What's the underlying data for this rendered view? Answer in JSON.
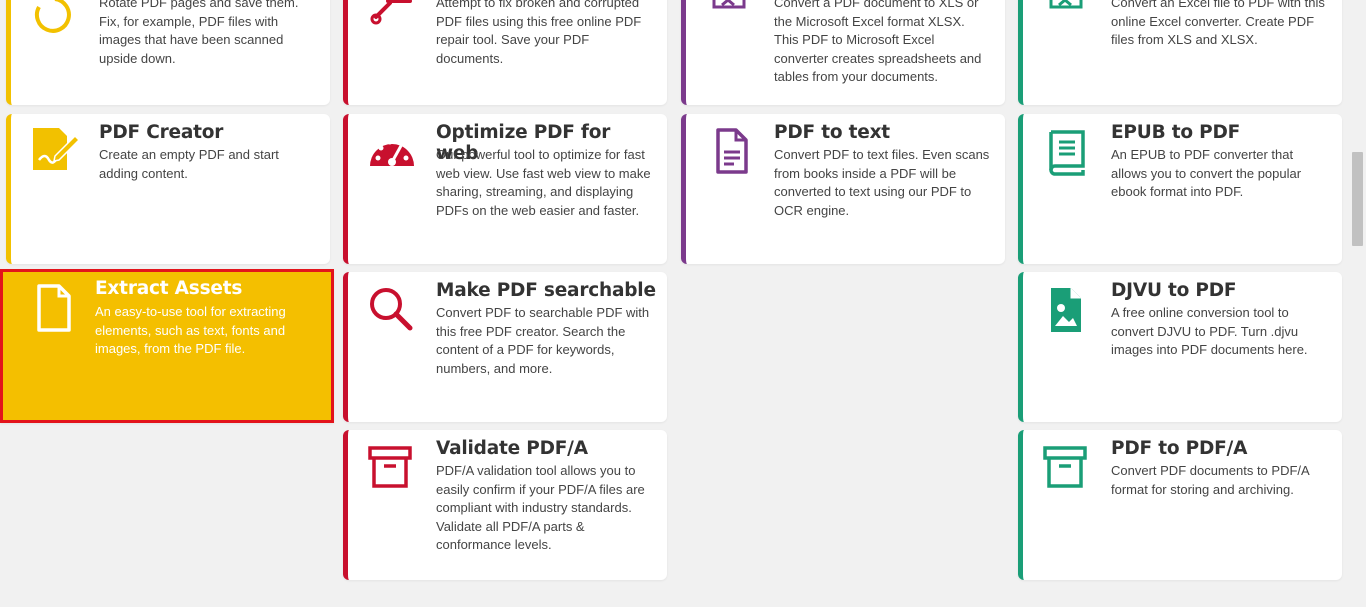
{
  "colors": {
    "yellow": "#f2c100",
    "red": "#c8102e",
    "purple": "#7b3a8c",
    "green": "#1a9e77",
    "highlight": "#f4bf00",
    "selection_border": "#e3141b"
  },
  "cards": {
    "rotate": {
      "desc": "Rotate PDF pages and save them. Fix, for example, PDF files with images that have been scanned upside down.",
      "icon": "rotate-icon"
    },
    "repair": {
      "desc": "Attempt to fix broken and corrupted PDF files using this free online PDF repair tool. Save your PDF documents.",
      "icon": "wrench-icon"
    },
    "pdf_to_excel": {
      "desc": "Convert a PDF document to XLS or the Microsoft Excel format XLSX. This PDF to Microsoft Excel converter creates spreadsheets and tables from your documents.",
      "icon": "excel-file-icon"
    },
    "excel_to_pdf": {
      "desc": "Convert an Excel file to PDF with this online Excel converter. Create PDF files from XLS and XLSX.",
      "icon": "excel-file-icon"
    },
    "pdf_creator": {
      "title": "PDF Creator",
      "desc": "Create an empty PDF and start adding content.",
      "icon": "sign-document-icon"
    },
    "optimize_web": {
      "title": "Optimize PDF for web",
      "desc": "Our powerful tool to optimize for fast web view. Use fast web view to make sharing, streaming, and displaying PDFs on the web easier and faster.",
      "icon": "speedometer-icon"
    },
    "pdf_to_text": {
      "title": "PDF to text",
      "desc": "Convert PDF to text files. Even scans from books inside a PDF will be converted to text using our PDF to OCR engine.",
      "icon": "text-file-icon"
    },
    "epub_to_pdf": {
      "title": "EPUB to PDF",
      "desc": "An EPUB to PDF converter that allows you to convert the popular ebook format into PDF.",
      "icon": "book-icon"
    },
    "extract_assets": {
      "title": "Extract Assets",
      "desc": "An easy-to-use tool for extracting elements, such as text, fonts and images, from the PDF file.",
      "icon": "file-icon"
    },
    "searchable": {
      "title": "Make PDF searchable",
      "desc": "Convert PDF to searchable PDF with this free PDF creator. Search the content of a PDF for keywords, numbers, and more.",
      "icon": "search-icon"
    },
    "djvu_to_pdf": {
      "title": "DJVU to PDF",
      "desc": "A free online conversion tool to convert DJVU to PDF. Turn .djvu images into PDF documents here.",
      "icon": "image-file-icon"
    },
    "validate_pdfa": {
      "title": "Validate PDF/A",
      "desc": "PDF/A validation tool allows you to easily confirm if your PDF/A files are compliant with industry standards. Validate all PDF/A parts & conformance levels.",
      "icon": "archive-icon"
    },
    "pdf_to_pdfa": {
      "title": "PDF to PDF/A",
      "desc": "Convert PDF documents to PDF/A format for storing and archiving.",
      "icon": "archive-icon"
    }
  }
}
